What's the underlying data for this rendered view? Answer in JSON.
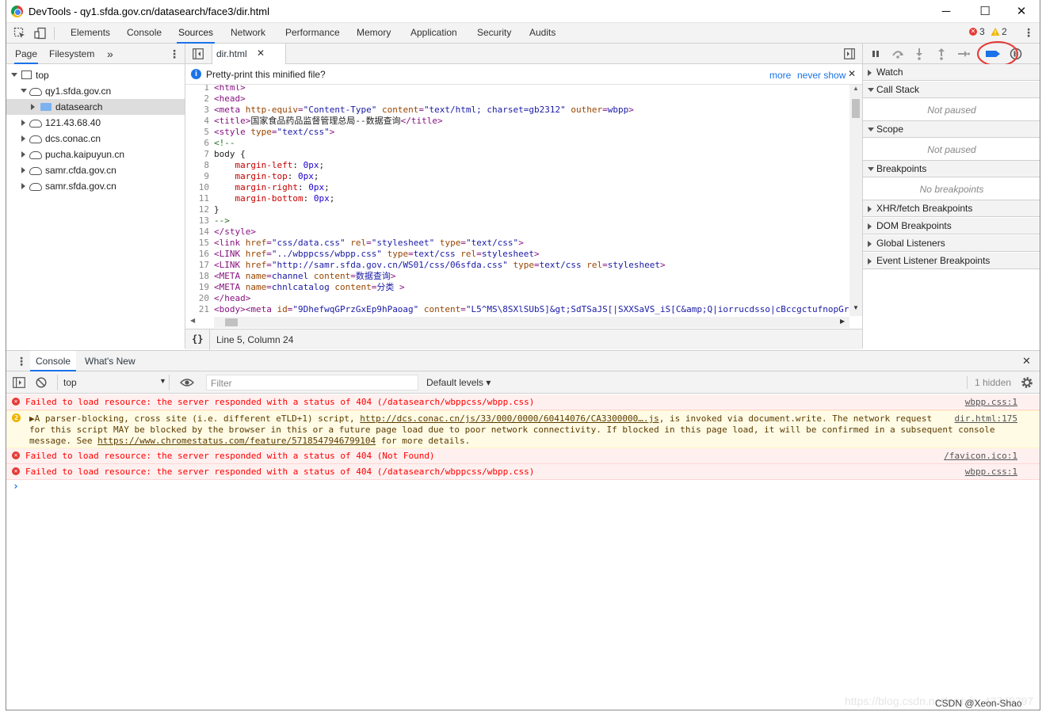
{
  "window": {
    "title": "DevTools - qy1.sfda.gov.cn/datasearch/face3/dir.html",
    "minimize": "─",
    "maximize": "☐",
    "close": "✕"
  },
  "main_tabs": [
    "Elements",
    "Console",
    "Sources",
    "Network",
    "Performance",
    "Memory",
    "Application",
    "Security",
    "Audits"
  ],
  "main_tabs_active": "Sources",
  "badges": {
    "errors": "3",
    "warnings": "2"
  },
  "navigator": {
    "tabs": [
      "Page",
      "Filesystem",
      "»"
    ],
    "tree": [
      {
        "label": "top"
      },
      {
        "label": "qy1.sfda.gov.cn"
      },
      {
        "label": "datasearch"
      },
      {
        "label": "121.43.68.40"
      },
      {
        "label": "dcs.conac.cn"
      },
      {
        "label": "pucha.kaipuyun.cn"
      },
      {
        "label": "samr.cfda.gov.cn"
      },
      {
        "label": "samr.sfda.gov.cn"
      }
    ]
  },
  "editor": {
    "file_tab": "dir.html",
    "infobar": {
      "message": "Pretty-print this minified file?",
      "more": "more",
      "never_show": "never show"
    },
    "status": "Line 5, Column 24",
    "format_button": "{}"
  },
  "code": [
    {
      "n": "1",
      "parts": [
        [
          "tag",
          "<html>"
        ]
      ]
    },
    {
      "n": "2",
      "parts": [
        [
          "tag",
          "<head>"
        ]
      ]
    },
    {
      "n": "3",
      "parts": [
        [
          "tag",
          "<meta "
        ],
        [
          "attr",
          "http-equiv"
        ],
        [
          "tag",
          "="
        ],
        [
          "val",
          "\"Content-Type\""
        ],
        [
          "attr",
          " content"
        ],
        [
          "tag",
          "="
        ],
        [
          "val",
          "\"text/html; charset=gb2312\""
        ],
        [
          "attr",
          " outher"
        ],
        [
          "tag",
          "="
        ],
        [
          "val",
          "wbpp"
        ],
        [
          "tag",
          ">"
        ]
      ]
    },
    {
      "n": "4",
      "parts": [
        [
          "tag",
          "<title>"
        ],
        [
          "txt",
          "国家食品药品监督管理总局--数据查询"
        ],
        [
          "tag",
          "</title>"
        ]
      ]
    },
    {
      "n": "5",
      "parts": [
        [
          "tag",
          "<style "
        ],
        [
          "attr",
          "type"
        ],
        [
          "tag",
          "="
        ],
        [
          "val",
          "\"text/css\""
        ],
        [
          "tag",
          ">"
        ]
      ]
    },
    {
      "n": "6",
      "parts": [
        [
          "cmt",
          "<!--"
        ]
      ]
    },
    {
      "n": "7",
      "parts": [
        [
          "txt",
          "body {"
        ]
      ]
    },
    {
      "n": "8",
      "parts": [
        [
          "txt",
          "    "
        ],
        [
          "prop",
          "margin-left"
        ],
        [
          "txt",
          ": "
        ],
        [
          "num",
          "0px"
        ],
        [
          "txt",
          ";"
        ]
      ]
    },
    {
      "n": "9",
      "parts": [
        [
          "txt",
          "    "
        ],
        [
          "prop",
          "margin-top"
        ],
        [
          "txt",
          ": "
        ],
        [
          "num",
          "0px"
        ],
        [
          "txt",
          ";"
        ]
      ]
    },
    {
      "n": "10",
      "parts": [
        [
          "txt",
          "    "
        ],
        [
          "prop",
          "margin-right"
        ],
        [
          "txt",
          ": "
        ],
        [
          "num",
          "0px"
        ],
        [
          "txt",
          ";"
        ]
      ]
    },
    {
      "n": "11",
      "parts": [
        [
          "txt",
          "    "
        ],
        [
          "prop",
          "margin-bottom"
        ],
        [
          "txt",
          ": "
        ],
        [
          "num",
          "0px"
        ],
        [
          "txt",
          ";"
        ]
      ]
    },
    {
      "n": "12",
      "parts": [
        [
          "txt",
          "}"
        ]
      ]
    },
    {
      "n": "13",
      "parts": [
        [
          "cmt",
          "-->"
        ]
      ]
    },
    {
      "n": "14",
      "parts": [
        [
          "tag",
          "</style>"
        ]
      ]
    },
    {
      "n": "15",
      "parts": [
        [
          "tag",
          "<link "
        ],
        [
          "attr",
          "href"
        ],
        [
          "tag",
          "="
        ],
        [
          "val",
          "\"css/data.css\""
        ],
        [
          "attr",
          " rel"
        ],
        [
          "tag",
          "="
        ],
        [
          "val",
          "\"stylesheet\""
        ],
        [
          "attr",
          " type"
        ],
        [
          "tag",
          "="
        ],
        [
          "val",
          "\"text/css\""
        ],
        [
          "tag",
          ">"
        ]
      ]
    },
    {
      "n": "16",
      "parts": [
        [
          "tag",
          "<LINK "
        ],
        [
          "attr",
          "href"
        ],
        [
          "tag",
          "="
        ],
        [
          "val",
          "\"../wbppcss/wbpp.css\""
        ],
        [
          "attr",
          " type"
        ],
        [
          "tag",
          "="
        ],
        [
          "val",
          "text/css"
        ],
        [
          "attr",
          " rel"
        ],
        [
          "tag",
          "="
        ],
        [
          "val",
          "stylesheet"
        ],
        [
          "tag",
          ">"
        ]
      ]
    },
    {
      "n": "17",
      "parts": [
        [
          "tag",
          "<LINK "
        ],
        [
          "attr",
          "href"
        ],
        [
          "tag",
          "="
        ],
        [
          "val",
          "\"http://samr.sfda.gov.cn/WS01/css/06sfda.css\""
        ],
        [
          "attr",
          " type"
        ],
        [
          "tag",
          "="
        ],
        [
          "val",
          "text/css"
        ],
        [
          "attr",
          " rel"
        ],
        [
          "tag",
          "="
        ],
        [
          "val",
          "stylesheet"
        ],
        [
          "tag",
          ">"
        ]
      ]
    },
    {
      "n": "18",
      "parts": [
        [
          "tag",
          "<META "
        ],
        [
          "attr",
          "name"
        ],
        [
          "tag",
          "="
        ],
        [
          "val",
          "channel"
        ],
        [
          "attr",
          " content"
        ],
        [
          "tag",
          "="
        ],
        [
          "val",
          "数据查询"
        ],
        [
          "tag",
          ">"
        ]
      ]
    },
    {
      "n": "19",
      "parts": [
        [
          "tag",
          "<META "
        ],
        [
          "attr",
          "name"
        ],
        [
          "tag",
          "="
        ],
        [
          "val",
          "chnlcatalog"
        ],
        [
          "attr",
          " content"
        ],
        [
          "tag",
          "="
        ],
        [
          "val",
          "分类"
        ],
        [
          "tag",
          " >"
        ]
      ]
    },
    {
      "n": "20",
      "parts": [
        [
          "tag",
          "</head>"
        ]
      ]
    },
    {
      "n": "21",
      "parts": [
        [
          "tag",
          "<body><meta "
        ],
        [
          "attr",
          "id"
        ],
        [
          "tag",
          "="
        ],
        [
          "val",
          "\"9DhefwqGPrzGxEp9hPaoag\""
        ],
        [
          "attr",
          " content"
        ],
        [
          "tag",
          "="
        ],
        [
          "val",
          "\"L5^MS\\8SXlSUbS]&gt;SdTSaJS[|SXXSaVS_iS[C&amp;Q|iorrucdsso|cBccgctufnopGr"
        ]
      ]
    },
    {
      "n": "22",
      "parts": []
    }
  ],
  "debugger": {
    "panes": [
      {
        "label": "Watch",
        "open": false
      },
      {
        "label": "Call Stack",
        "open": true,
        "body": "Not paused"
      },
      {
        "label": "Scope",
        "open": true,
        "body": "Not paused"
      },
      {
        "label": "Breakpoints",
        "open": true,
        "body": "No breakpoints"
      },
      {
        "label": "XHR/fetch Breakpoints",
        "open": false
      },
      {
        "label": "DOM Breakpoints",
        "open": false
      },
      {
        "label": "Global Listeners",
        "open": false
      },
      {
        "label": "Event Listener Breakpoints",
        "open": false
      }
    ]
  },
  "drawer": {
    "tabs": [
      "Console",
      "What's New"
    ],
    "context": "top",
    "filter_placeholder": "Filter",
    "levels": "Default levels ▾",
    "hidden": "1 hidden",
    "messages": [
      {
        "type": "error",
        "text": "Failed to load resource: the server responded with a status of 404 (/datasearch/wbppcss/wbpp.css)",
        "source": "wbpp.css:1"
      },
      {
        "type": "warn",
        "count": "2",
        "line1_pre": "▶A parser-blocking, cross site (i.e. different eTLD+1) script, ",
        "line1_link": "http://dcs.conac.cn/js/33/000/0000/60414076/CA3300000….js",
        "line1_post": ", is invoked via document.write. The network request",
        "line2": "for this script MAY be blocked by the browser in this or a future page load due to poor network connectivity. If blocked in this page load, it will be confirmed in a subsequent console",
        "line3_pre": "message. See ",
        "line3_link": "https://www.chromestatus.com/feature/5718547946799104",
        "line3_post": " for more details.",
        "source": "dir.html:175"
      },
      {
        "type": "error",
        "text": "Failed to load resource: the server responded with a status of 404 (Not Found)",
        "source": "/favicon.ico:1"
      },
      {
        "type": "error",
        "text": "Failed to load resource: the server responded with a status of 404 (/datasearch/wbppcss/wbpp.css)",
        "source": "wbpp.css:1"
      }
    ],
    "prompt": "›"
  },
  "watermark": "https://blog.csdn.net/weixin_43749397",
  "watermark_label": "CSDN @Xeon-Shao",
  "colors": {
    "accent": "#1a73e8",
    "error": "#fe0000",
    "highlight_circle": "#e53935"
  }
}
